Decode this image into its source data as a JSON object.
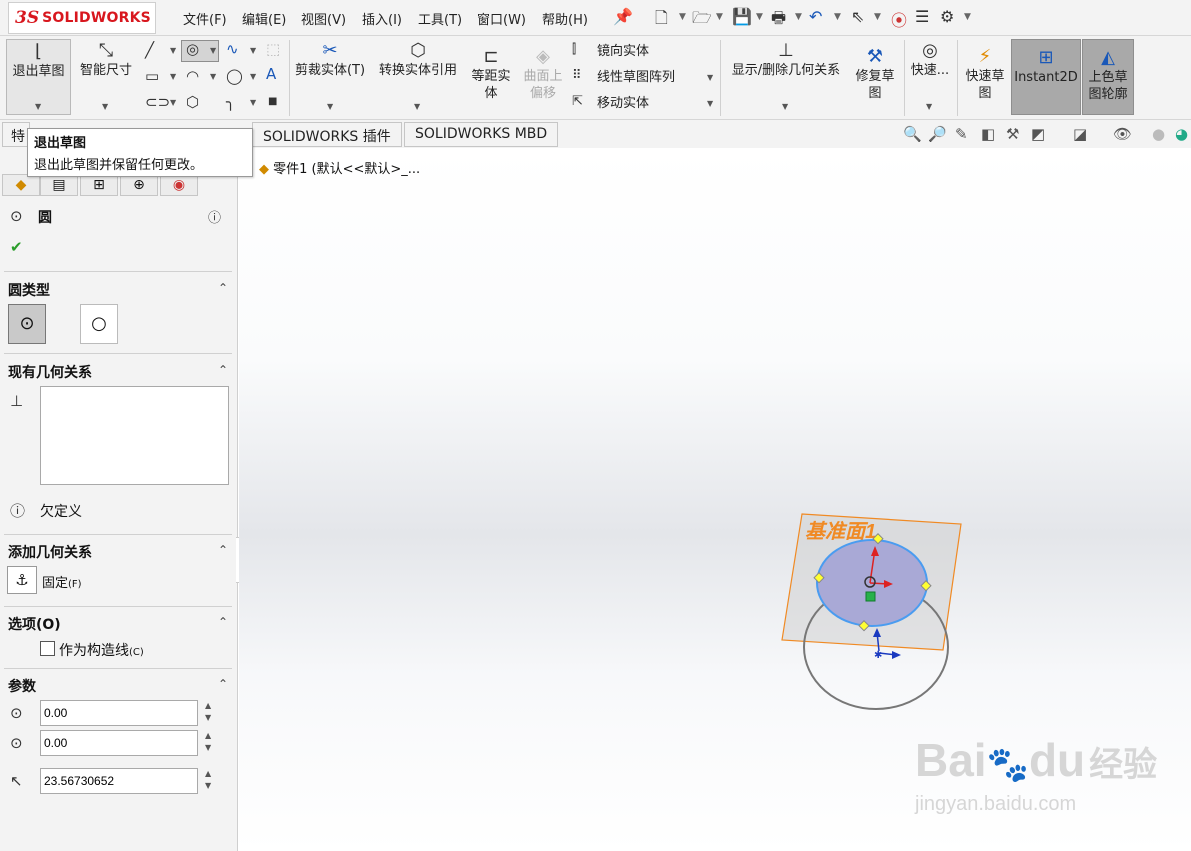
{
  "app": {
    "logo_text": "SOLIDWORKS",
    "logo_mark": "3S"
  },
  "menu": [
    "文件(F)",
    "编辑(E)",
    "视图(V)",
    "插入(I)",
    "工具(T)",
    "窗口(W)",
    "帮助(H)"
  ],
  "ribbon": {
    "exit_sketch": "退出草图",
    "smart_dimension": "智能尺寸",
    "trim_entities": "剪裁实体(T)",
    "convert_entities": "转换实体引用",
    "offset_entities_1": "等距实",
    "offset_entities_2": "体",
    "surface_offset_1": "曲面上",
    "surface_offset_2": "偏移",
    "mirror_entities": "镜向实体",
    "linear_pattern": "线性草图阵列",
    "move_entities": "移动实体",
    "display_relations": "显示/删除几何关系",
    "repair_sketch_1": "修复草",
    "repair_sketch_2": "图",
    "quick_snaps": "快速...",
    "rapid_sketch_1": "快速草",
    "rapid_sketch_2": "图",
    "instant2d": "Instant2D",
    "shaded_sketch_1": "上色草",
    "shaded_sketch_2": "图轮廓"
  },
  "tabs": {
    "features_partial": "特",
    "plugins": "SOLIDWORKS 插件",
    "mbd": "SOLIDWORKS MBD"
  },
  "tooltip": {
    "title": "退出草图",
    "description": "退出此草图并保留任何更改。"
  },
  "feature_tree": {
    "item": "零件1  (默认<<默认>_..."
  },
  "panel": {
    "title": "圆",
    "circle_type_header": "圆类型",
    "existing_relations_header": "现有几何关系",
    "status": "欠定义",
    "add_relations_header": "添加几何关系",
    "fixed_label": "固定",
    "fixed_shortcut": "(F)",
    "options_header": "选项(O)",
    "construction_label": "作为构造线",
    "construction_shortcut": "(C)",
    "construction_checked": false,
    "params_header": "参数",
    "center_x": "0.00",
    "center_y": "0.00",
    "radius": "23.56730652"
  },
  "viewport": {
    "plane_label": "基准面1"
  },
  "watermark": {
    "brand_left": "Bai",
    "brand_right": "du",
    "brand_suffix": "经验",
    "url": "jingyan.baidu.com"
  },
  "colors": {
    "brand_red": "#d8171e",
    "plane_orange": "#f08a24",
    "circle_fill": "#a9a9d6",
    "circle_edge": "#4a9cf0",
    "active_button": "#a9a9a9"
  }
}
